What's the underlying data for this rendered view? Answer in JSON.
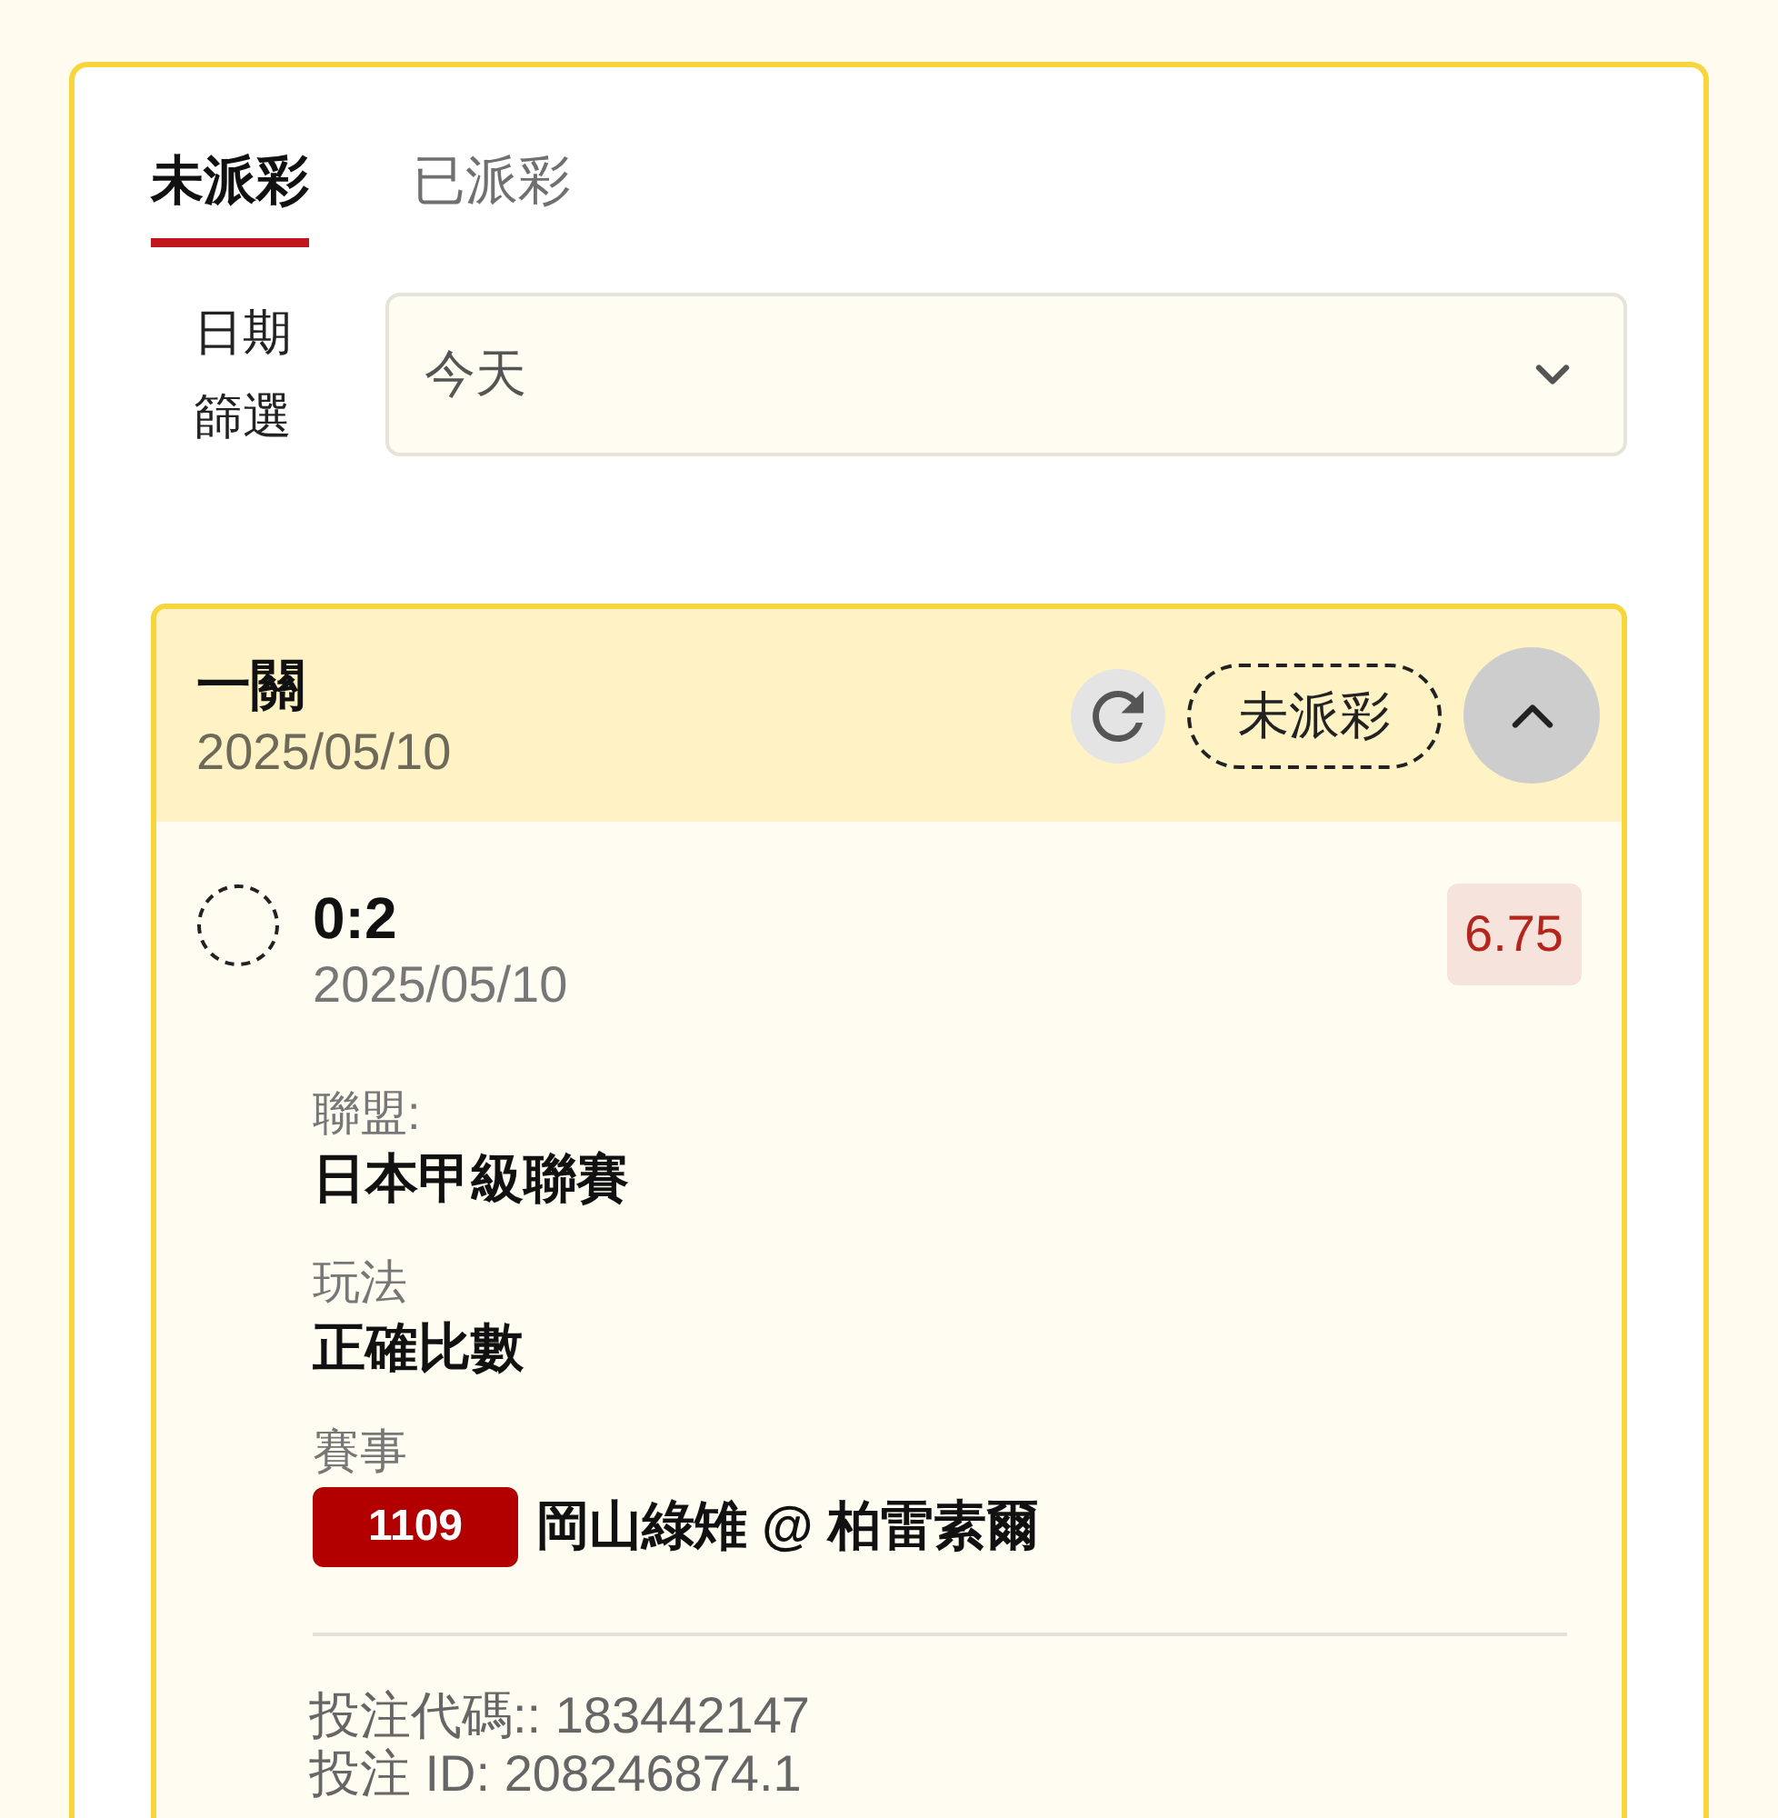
{
  "tabs": [
    {
      "label": "未派彩",
      "selected": true
    },
    {
      "label": "已派彩",
      "selected": false
    }
  ],
  "date_filter": {
    "label": "日期篩選",
    "value": "今天"
  },
  "bet": {
    "title": "一關",
    "date": "2025/05/10",
    "status": "未派彩",
    "expanded": true,
    "selections": [
      {
        "result": "0:2",
        "date": "2025/05/10",
        "odds": "6.75",
        "fields": [
          {
            "kind": "text",
            "label": "聯盟:",
            "value": "日本甲級聯賽"
          },
          {
            "kind": "text",
            "label": "玩法",
            "value": "正確比數"
          },
          {
            "kind": "match",
            "label": "賽事",
            "match_number": "1109",
            "value": "岡山綠雉 @ 柏雷素爾"
          }
        ]
      }
    ],
    "footer": [
      "投注代碼:: 183442147",
      "投注 ID: 208246874.1"
    ]
  }
}
